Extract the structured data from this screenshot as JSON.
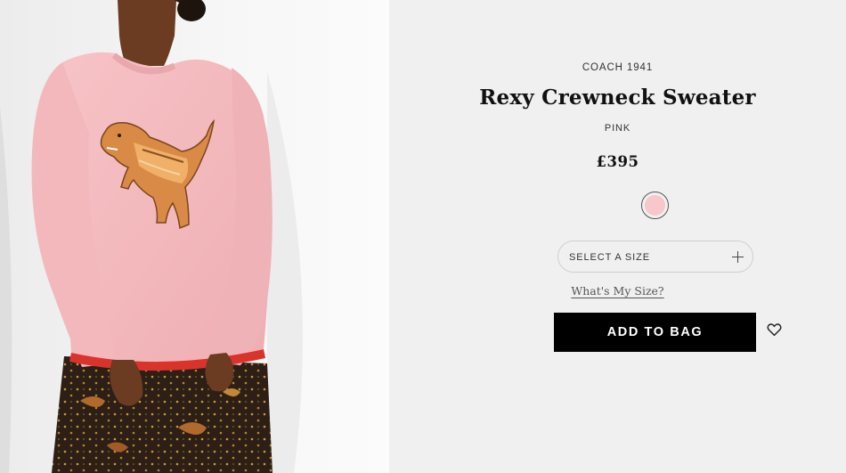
{
  "product": {
    "brand": "COACH 1941",
    "name": "Rexy Crewneck Sweater",
    "color_name": "PINK",
    "price": "£395",
    "swatch_color": "#f6c7cb"
  },
  "size": {
    "label": "SELECT A SIZE",
    "guide_link": "What's My Size?"
  },
  "actions": {
    "add_to_bag": "ADD TO BAG",
    "wishlist_icon": "heart-icon",
    "size_expand_icon": "plus-icon"
  },
  "image": {
    "subject": "model-wearing-pink-sweater-with-dinosaur",
    "sweater_color": "#f4b9bd",
    "trim_color": "#d9332c"
  }
}
